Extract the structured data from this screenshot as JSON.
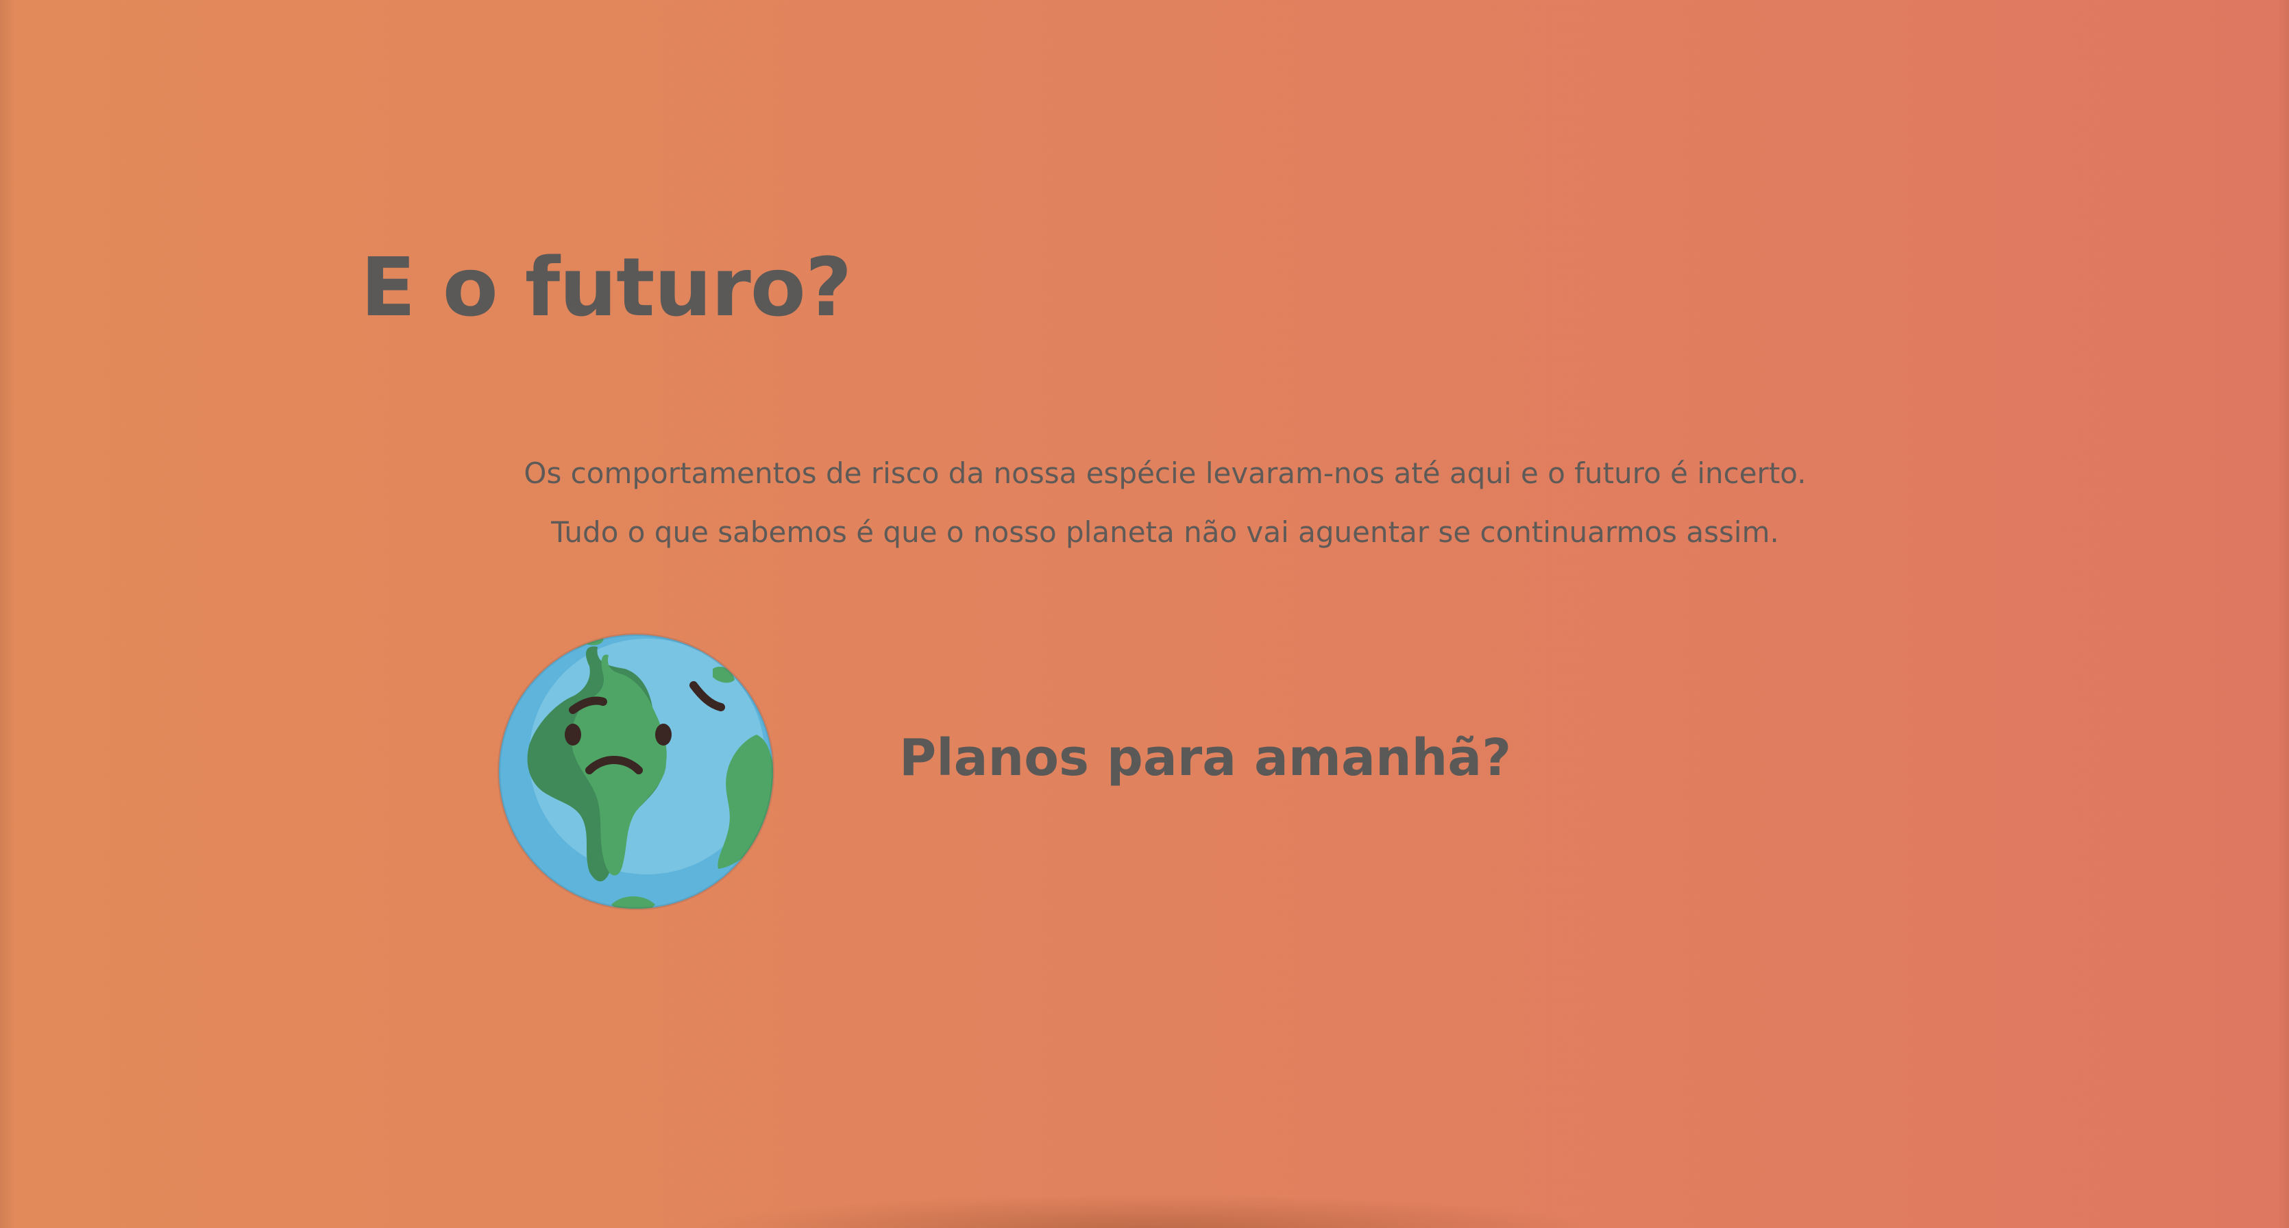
{
  "section": {
    "title": "E o futuro?",
    "intro_lines": [
      "Os comportamentos de risco da nossa espécie levaram-nos até aqui e o futuro é incerto.",
      "Tudo o que sabemos é que o nosso planeta não vai aguentar se continuarmos assim."
    ],
    "subtitle": "Planos para amanhã?"
  },
  "illustration": {
    "icon": "sad-earth-icon"
  },
  "colors": {
    "background_start": "#e28a5a",
    "background_end": "#df7860",
    "text": "#5a5957",
    "ocean": "#6cbde0",
    "land": "#4a9e62"
  }
}
